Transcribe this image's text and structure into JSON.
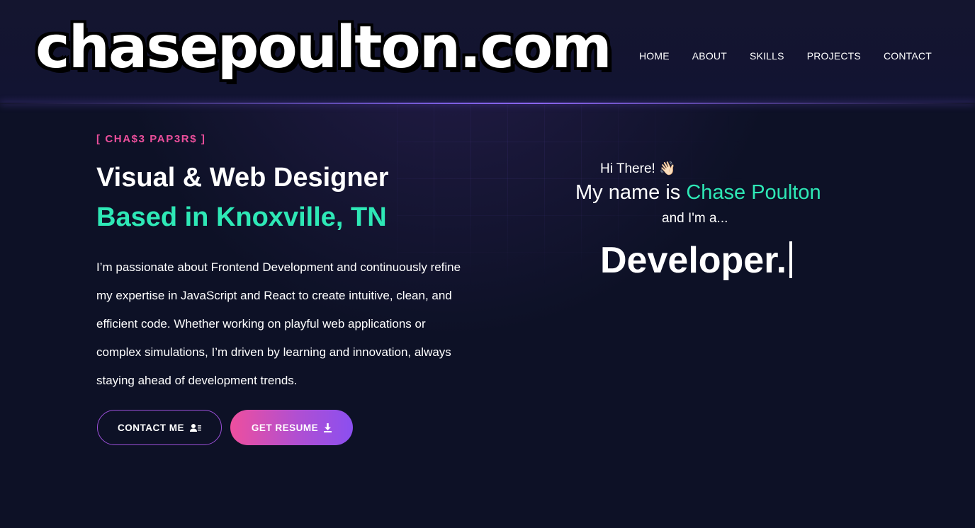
{
  "logo": {
    "text": "chasepoulton.com"
  },
  "nav": {
    "items": [
      {
        "label": "HOME"
      },
      {
        "label": "ABOUT"
      },
      {
        "label": "SKILLS"
      },
      {
        "label": "PROJECTS"
      },
      {
        "label": "CONTACT"
      }
    ]
  },
  "hero": {
    "kicker": "[ CHA$3 PAP3R$ ]",
    "headline_line1": "Visual & Web Designer",
    "headline_line2": "Based in Knoxville, TN",
    "bio": "I’m passionate about Frontend Development and continuously refine my expertise in JavaScript and React to create intuitive, clean, and efficient code. Whether working on playful web applications or complex simulations, I’m driven by learning and innovation, always staying ahead of development trends.",
    "contact_button": {
      "label": "CONTACT ME",
      "icon": "contact-card-icon"
    },
    "resume_button": {
      "label": "GET RESUME",
      "icon": "download-icon"
    }
  },
  "intro": {
    "greeting": "Hi There!",
    "wave_emoji": "👋🏻",
    "name_prefix": "My name is",
    "name": "Chase Poulton",
    "and_text": "and I'm a...",
    "role": "Developer."
  },
  "colors": {
    "background": "#0d1126",
    "accent_teal": "#2ee8b6",
    "accent_pink": "#ec4f9c",
    "accent_purple": "#8b4ff0"
  }
}
